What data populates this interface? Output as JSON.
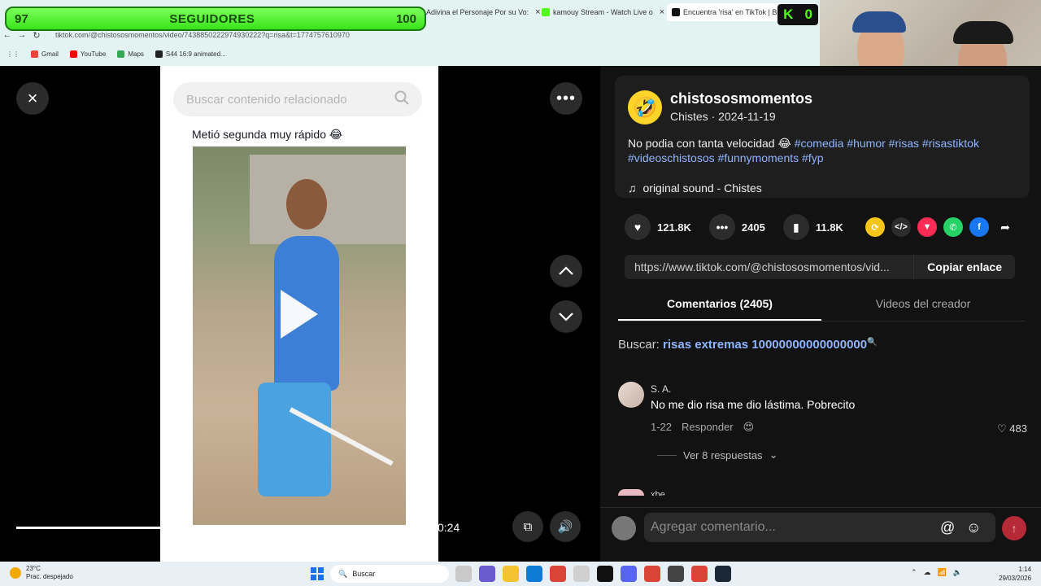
{
  "overlay": {
    "follow_current": "97",
    "follow_label": "SEGUIDORES",
    "follow_goal": "100",
    "kick_badge": "0"
  },
  "browser": {
    "tabs": [
      {
        "label": "Adivina el Personaje Por su Vo:",
        "close": "×"
      },
      {
        "label": "kamouy Stream - Watch Live o",
        "close": "×"
      },
      {
        "label": "Encuentra 'risa' en TikTok | Bus",
        "close": "×"
      }
    ],
    "url": "tiktok.com/@chistososmomentos/video/7438850222974930222?q=risa&t=1774757610970",
    "bookmarks": [
      "Gmail",
      "YouTube",
      "Maps",
      "S44 16:9 animated..."
    ]
  },
  "player": {
    "close_icon": "×",
    "more_icon": "•••",
    "search_placeholder": "Buscar contenido relacionado",
    "video_caption": "Metió segunda muy rápido 😂",
    "time": "0:24",
    "colors": {
      "accent_red": "#fe2c55"
    }
  },
  "post": {
    "author": "chistososmomentos",
    "subline": "Chistes · 2024-11-19",
    "description": "No podia con tanta velocidad 😂",
    "hashtags": [
      "#comedia",
      "#humor",
      "#risas",
      "#risastiktok",
      "#videoschistosos",
      "#funnymoments",
      "#fyp"
    ],
    "music": "original sound - Chistes",
    "likes": "121.8K",
    "comments": "2405",
    "saves": "11.8K",
    "link": "https://www.tiktok.com/@chistososmomentos/vid...",
    "copy_label": "Copiar enlace"
  },
  "tabs": {
    "comments": "Comentarios (2405)",
    "creator_videos": "Videos del creador"
  },
  "related_search": {
    "label": "Buscar:",
    "query": "risas extremas 10000000000000000"
  },
  "comment": {
    "user": "S. A.",
    "text": "No me dio risa me dio lástima. Pobrecito",
    "date": "1-22",
    "reply_label": "Responder",
    "likes": "483",
    "replies": "Ver 8 respuestas",
    "next_user": "xbe"
  },
  "compose": {
    "placeholder": "Agregar comentario..."
  },
  "taskbar": {
    "temp": "23°C",
    "weather": "Prac. despejado",
    "search": "Buscar",
    "time": "1:14",
    "date": "29/03/2026"
  }
}
